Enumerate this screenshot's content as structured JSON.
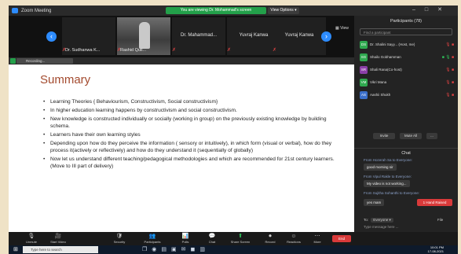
{
  "window": {
    "title": "Zoom Meeting"
  },
  "share_banner": "You are viewing Dr. Mohammad's screen",
  "view_options": "View Options ▾",
  "window_controls": [
    "–",
    "□",
    "✕"
  ],
  "thumbnails": [
    {
      "name": "Dr. Sudhanwa K...",
      "kind": "named"
    },
    {
      "name": "Rashid Quil...",
      "kind": "video"
    },
    {
      "name": "Dr. Mahammad...",
      "kind": "named"
    },
    {
      "name": "Yuvraj Kanwa",
      "kind": "named"
    },
    {
      "name": "Yuvraj Kanwa",
      "kind": "named"
    }
  ],
  "gallery_label": "▦ View",
  "spotlight": {
    "label": "Recording..."
  },
  "slide": {
    "title": "Summary",
    "bullets": [
      "Learning Theories { Behaviourism, Constructivism, Social constructivism}",
      "In higher education learning happens by constructivism and social constructivism.",
      "New knowledge is constructed individually or socially (working in group) on the previously existing knowledge by building schema.",
      "Learners have their own learning styles",
      "Depending upon how do they perceive the information ( sensory or intuitively), in which form (visual or verbal), how do they process it(actively or reflectively) and how do they understand it (sequentially of globally)",
      "Now let us understand different teaching/pedagogical methodologies and which are recommended for 21st century learners. (Move to III part of delivery)"
    ]
  },
  "participants_panel": {
    "title": "Participants (78)",
    "search_placeholder": "Find a participant",
    "participants": [
      {
        "initials": "DS",
        "name": "Dr. Shalini Sayy... (Host, me)",
        "color": "#2fa84f"
      },
      {
        "initials": "SG",
        "name": "Shailo Gobhamman",
        "color": "#2fa84f"
      },
      {
        "initials": "SR",
        "name": "Shali Rana(Co-host)",
        "color": "#8b3fa8"
      },
      {
        "initials": "VM",
        "name": "Vikri Mana",
        "color": "#2fa84f"
      },
      {
        "initials": "AS",
        "name": "Aashii Shukh",
        "color": "#3b6fc9"
      }
    ],
    "invite_label": "Invite",
    "mute_all_label": "Mute All",
    "more_label": "..."
  },
  "chat": {
    "title": "Chat",
    "messages": [
      {
        "sender": "From Hozerah Sa to Everyone:",
        "text": "good morning sir"
      },
      {
        "sender": "From Vipul Rakle to Everyone:",
        "text": "My video is not working..."
      },
      {
        "sender": "From Sujitha Sohanthi to Everyone:",
        "text": "yes mam"
      }
    ],
    "raised_hand": "1 Hand Raised",
    "to_label": "To:",
    "to_value": "Everyone ▾",
    "file_label": "File",
    "input_placeholder": "Type message here ..."
  },
  "toolbar": [
    {
      "icon": "🎙",
      "label": "Unmute",
      "green": false
    },
    {
      "icon": "🎥",
      "label": "Start Video",
      "green": false
    },
    {
      "icon": "🛡",
      "label": "Security",
      "green": false
    },
    {
      "icon": "👥",
      "label": "Participants",
      "green": false
    },
    {
      "icon": "📊",
      "label": "Polls",
      "green": false
    },
    {
      "icon": "💬",
      "label": "Chat",
      "green": false
    },
    {
      "icon": "⬆",
      "label": "Share Screen",
      "green": true
    },
    {
      "icon": "⏺",
      "label": "Record",
      "green": false
    },
    {
      "icon": "☺",
      "label": "Reactions",
      "green": false
    },
    {
      "icon": "⋯",
      "label": "More",
      "green": false
    }
  ],
  "end_label": "End",
  "taskbar": {
    "search_placeholder": "Type here to search",
    "time": "10:01 PM",
    "date": "17-08-2021"
  }
}
